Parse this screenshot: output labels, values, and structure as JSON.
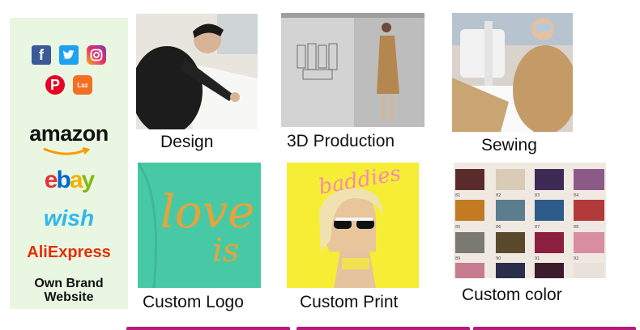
{
  "sidebar": {
    "social": [
      "facebook-icon",
      "twitter-icon",
      "instagram-icon",
      "pinterest-icon",
      "lazada-icon"
    ],
    "lazada_text": "Laz",
    "amazon": "amazon",
    "ebay": [
      "e",
      "b",
      "a",
      "y"
    ],
    "wish": "wish",
    "aliexpress": "AliExpress",
    "own_brand": "Own Brand",
    "website": "Website"
  },
  "tiles": [
    {
      "caption": "Design"
    },
    {
      "caption": "3D Production"
    },
    {
      "caption": "Sewing"
    },
    {
      "caption": "Custom Logo",
      "shirt_text_1": "love",
      "shirt_text_2": "is"
    },
    {
      "caption": "Custom Print",
      "print_text": "baddies"
    },
    {
      "caption": "Custom color",
      "swatch_labels": [
        "81",
        "82",
        "83",
        "84",
        "85",
        "86",
        "87",
        "88",
        "89",
        "90",
        "91",
        "92"
      ]
    }
  ],
  "colors": {
    "ebay": [
      "#e53238",
      "#0064d2",
      "#f5af02",
      "#86b817"
    ],
    "accent": "#b81a7b"
  }
}
